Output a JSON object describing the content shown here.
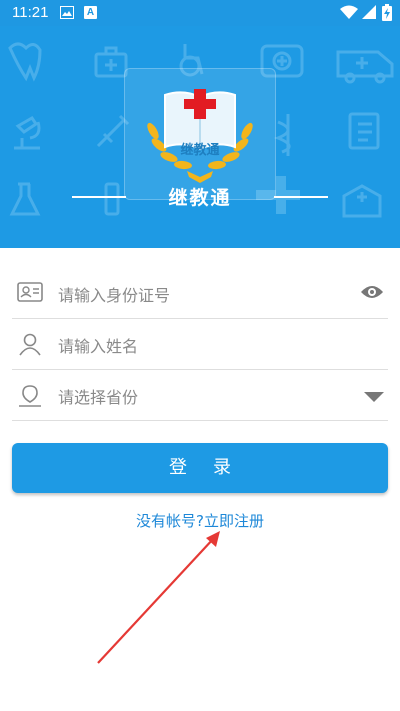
{
  "status_bar": {
    "time": "11:21",
    "icons": [
      "image-icon",
      "a-letter-icon",
      "wifi-icon",
      "signal-icon",
      "battery-charging-icon"
    ],
    "a_icon_letter": "A"
  },
  "header": {
    "logo_text": "继教通",
    "app_title": "继教通",
    "background_color": "#1e9ae4"
  },
  "form": {
    "id_card_placeholder": "请输入身份证号",
    "name_placeholder": "请输入姓名",
    "province_placeholder": "请选择省份"
  },
  "login_button_label": "登录",
  "register_link_text": "没有帐号?立即注册",
  "colors": {
    "accent": "#1e9ae4",
    "link": "#1e88d8",
    "annotation_arrow": "#e53935"
  }
}
